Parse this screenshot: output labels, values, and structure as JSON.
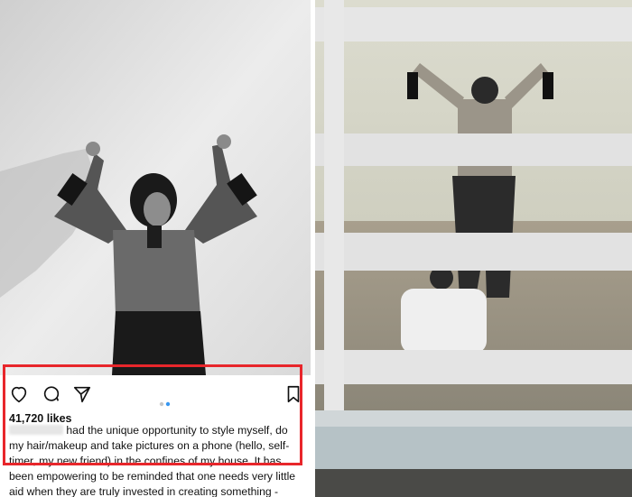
{
  "post": {
    "likes": "41,720 likes",
    "caption_blurred_username": "",
    "caption": "had the unique opportunity to style myself, do my hair/makeup and take pictures on a phone (hello, self-timer, my new friend) in the confines of my house. It has been empowering to be reminded that one needs very little aid when they are truly invested in creating something - even if it"
  },
  "icons": {
    "like": "heart-icon",
    "comment": "comment-icon",
    "share": "share-icon",
    "save": "bookmark-icon"
  },
  "colors": {
    "highlight_box": "#e8262b",
    "dot_active": "#3897f0",
    "dot_inactive": "#c7c7c7"
  }
}
